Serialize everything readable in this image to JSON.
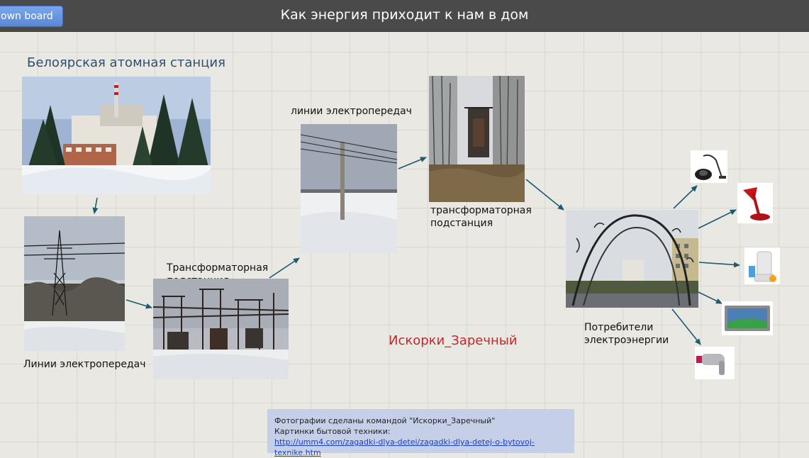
{
  "topbar": {
    "board_button": "own board",
    "title": "Как энергия приходит к нам в дом"
  },
  "labels": {
    "npp_title": "Белоярская атомная станция",
    "lines_1": "Линии электропередач",
    "substation_1_line1": "Трансформаторная",
    "substation_1_line2": "подстанция",
    "lines_2": "линии электропередач",
    "substation_2_line1": "трансформаторная",
    "substation_2_line2": "подстанция",
    "consumers_line1": "Потребители",
    "consumers_line2": "электроэнергии",
    "team": "Искорки_Заречный"
  },
  "credits": {
    "line1": "Фотографии сделаны командой \"Искорки_Заречный\"",
    "line2": "Картинки бытовой техники:",
    "link": "http://umm4.com/zagadki-dlya-detei/zagadki-dlya-detej-o-bytovoj-texnike.htm"
  },
  "colors": {
    "arrow": "#1d5a6e",
    "title_blue": "#2e4e6e",
    "team_red": "#c0282d"
  },
  "icons": [
    "vacuum-cleaner-icon",
    "desk-lamp-icon",
    "juicer-icon",
    "tv-icon",
    "hair-dryer-icon"
  ]
}
